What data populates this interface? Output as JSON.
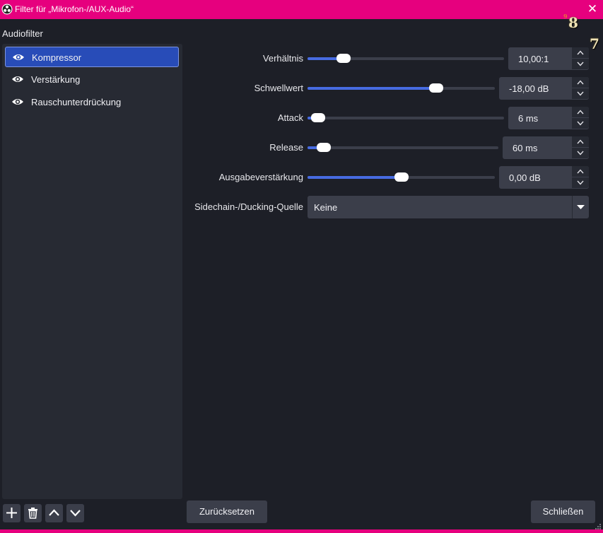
{
  "window": {
    "title": "Filter für „Mikrofon-/AUX-Audio“",
    "close_glyph": "✕",
    "overlay_numbers": [
      "9",
      "8",
      "7"
    ]
  },
  "colors": {
    "titlebar": "#e6007e",
    "accent": "#284cb8",
    "slider_fill": "#476be1",
    "panel": "#272a33",
    "background": "#1d1f27"
  },
  "sidebar": {
    "title": "Audiofilter",
    "items": [
      {
        "label": "Kompressor",
        "icon": "eye-icon",
        "selected": true
      },
      {
        "label": "Verstärkung",
        "icon": "eye-icon",
        "selected": false
      },
      {
        "label": "Rauschunterdrückung",
        "icon": "eye-icon",
        "selected": false
      }
    ],
    "actions": [
      "plus-icon",
      "trash-icon",
      "chevron-up-icon",
      "chevron-down-icon"
    ]
  },
  "properties": {
    "ratio": {
      "label": "Verhältnis",
      "value": "10,00:1",
      "level": 0.16
    },
    "threshold": {
      "label": "Schwellwert",
      "value": "-18,00 dB",
      "level": 0.7
    },
    "attack": {
      "label": "Attack",
      "value": "6 ms",
      "level": 0.02
    },
    "release": {
      "label": "Release",
      "value": "60 ms",
      "level": 0.05
    },
    "output_gain": {
      "label": "Ausgabeverstärkung",
      "value": "0,00 dB",
      "level": 0.5
    },
    "sidechain": {
      "label": "Sidechain-/Ducking-Quelle",
      "value": "Keine"
    }
  },
  "buttons": {
    "reset": "Zurücksetzen",
    "close": "Schließen"
  }
}
